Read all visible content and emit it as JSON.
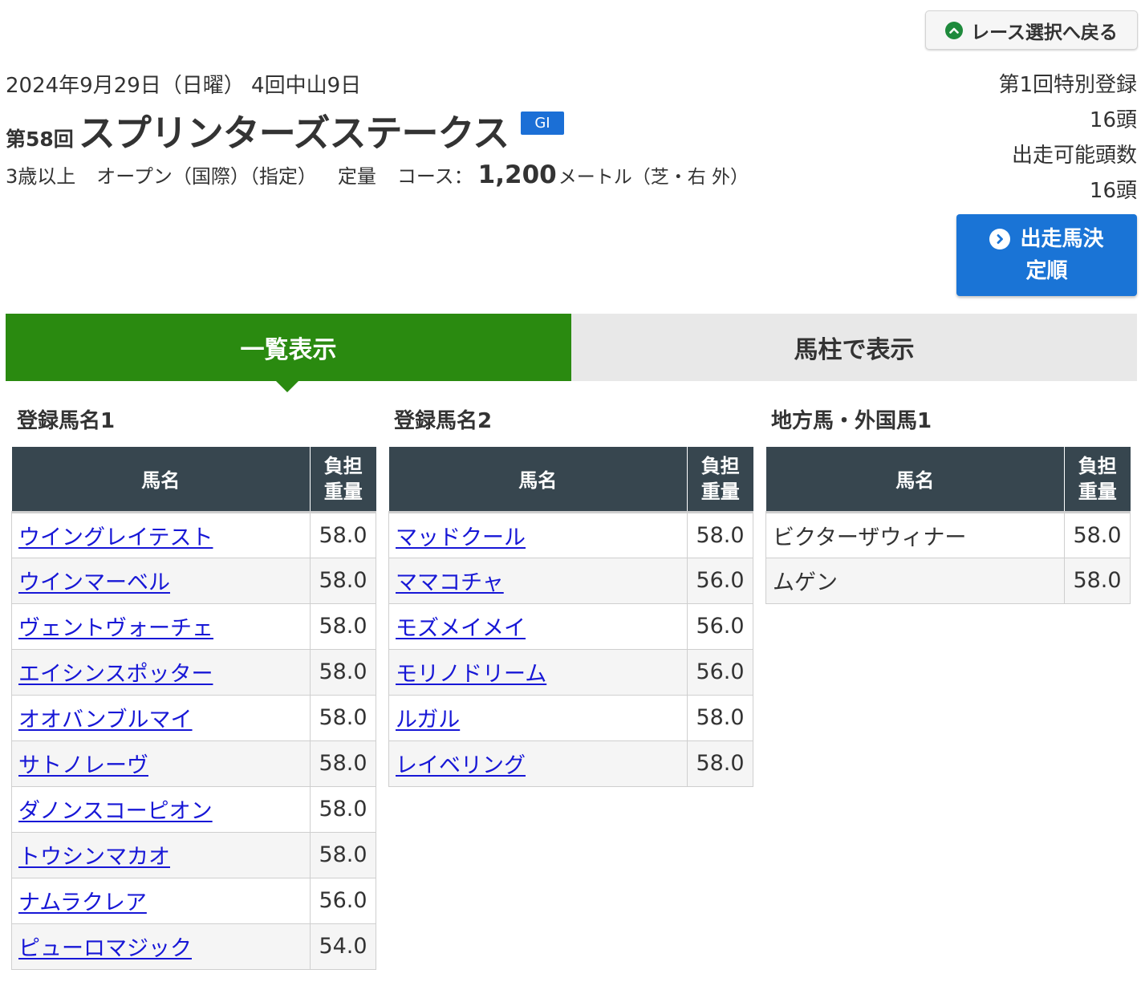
{
  "back_button": {
    "label": "レース選択へ戻る",
    "icon": "chevron-up-icon"
  },
  "race": {
    "date": "2024年9月29日（日曜） 4回中山9日",
    "kai": "第58回",
    "name": "スプリンターズステークス",
    "grade": "GI",
    "age_class": "3歳以上",
    "class": "オープン（国際）（指定）",
    "weight_rule": "定量",
    "course_label": "コース：",
    "distance": "1,200",
    "distance_unit": "メートル（芝・右 外）"
  },
  "registration": {
    "round": "第1回特別登録",
    "count": "16頭",
    "eligible_label": "出走可能頭数",
    "eligible_count": "16頭"
  },
  "entry_button": {
    "line1": "出走馬決",
    "line2": "定順",
    "icon": "chevron-right-icon"
  },
  "tabs": [
    {
      "label": "一覧表示",
      "active": true
    },
    {
      "label": "馬柱で表示",
      "active": false
    }
  ],
  "columns": {
    "name": "馬名",
    "weight_line1": "負担",
    "weight_line2": "重量"
  },
  "groups": [
    {
      "title": "登録馬名1",
      "rows": [
        {
          "name": "ウイングレイテスト",
          "weight": "58.0",
          "link": true
        },
        {
          "name": "ウインマーベル",
          "weight": "58.0",
          "link": true
        },
        {
          "name": "ヴェントヴォーチェ",
          "weight": "58.0",
          "link": true
        },
        {
          "name": "エイシンスポッター",
          "weight": "58.0",
          "link": true
        },
        {
          "name": "オオバンブルマイ",
          "weight": "58.0",
          "link": true
        },
        {
          "name": "サトノレーヴ",
          "weight": "58.0",
          "link": true
        },
        {
          "name": "ダノンスコーピオン",
          "weight": "58.0",
          "link": true
        },
        {
          "name": "トウシンマカオ",
          "weight": "58.0",
          "link": true
        },
        {
          "name": "ナムラクレア",
          "weight": "56.0",
          "link": true
        },
        {
          "name": "ピューロマジック",
          "weight": "54.0",
          "link": true
        }
      ]
    },
    {
      "title": "登録馬名2",
      "rows": [
        {
          "name": "マッドクール",
          "weight": "58.0",
          "link": true
        },
        {
          "name": "ママコチャ",
          "weight": "56.0",
          "link": true
        },
        {
          "name": "モズメイメイ",
          "weight": "56.0",
          "link": true
        },
        {
          "name": "モリノドリーム",
          "weight": "56.0",
          "link": true
        },
        {
          "name": "ルガル",
          "weight": "58.0",
          "link": true
        },
        {
          "name": "レイベリング",
          "weight": "58.0",
          "link": true
        }
      ]
    },
    {
      "title": "地方馬・外国馬1",
      "rows": [
        {
          "name": "ビクターザウィナー",
          "weight": "58.0",
          "link": false
        },
        {
          "name": "ムゲン",
          "weight": "58.0",
          "link": false
        }
      ]
    }
  ]
}
